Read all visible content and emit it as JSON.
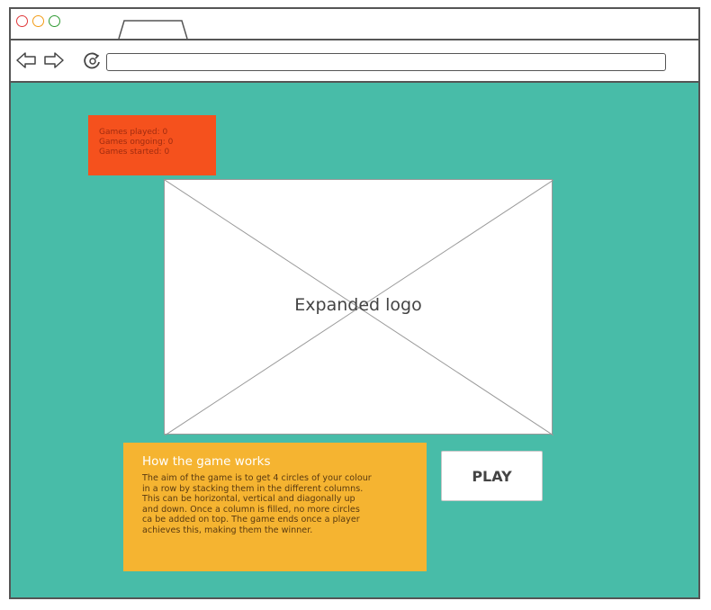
{
  "browser": {
    "window_controls": [
      "close-dot",
      "minimize-dot",
      "maximize-dot"
    ],
    "nav_icons": [
      "back-arrow-icon",
      "forward-arrow-icon",
      "reload-icon"
    ],
    "url": ""
  },
  "stats": {
    "games_played": "Games played: 0",
    "games_ongoing": "Games ongoing: 0",
    "games_started": "Games started: 0"
  },
  "logo": {
    "label": "Expanded logo"
  },
  "howto": {
    "title": "How the game works",
    "body": "The aim of the game is to get 4 circles of your colour\nin a row by stacking them in the different columns.\nThis can be horizontal, vertical and diagonally up\nand  down. Once a column is filled, no more circles\nca be added on top. The game ends once a player\nachieves this, making them the winner."
  },
  "play_button": {
    "label": "PLAY"
  },
  "colors": {
    "background": "#48bca8",
    "stats_box": "#f5511d",
    "howto_box": "#f5b431"
  }
}
